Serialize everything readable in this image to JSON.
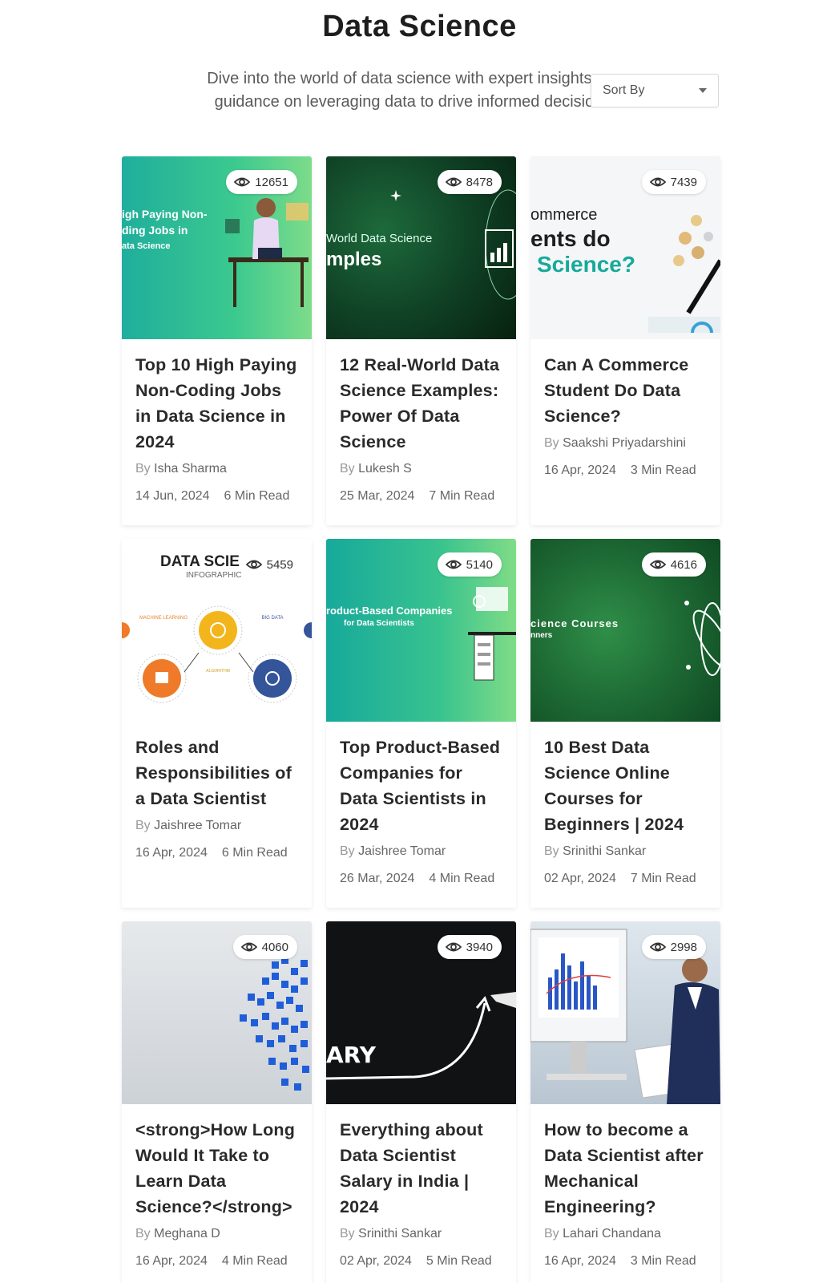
{
  "header": {
    "title": "Data Science",
    "subtitle_line1": "Dive into the world of data science with expert insights ar",
    "subtitle_line2": "guidance on leveraging data to drive informed decision",
    "sort_label": "Sort By"
  },
  "colors": {
    "title": "#1e1e1e",
    "text_muted": "#666666",
    "card_shadow": "rgba(0,0,0,0.08)"
  },
  "cards": [
    {
      "views": "12651",
      "thumb_lines": [
        "igh Paying Non-",
        "ding Jobs in",
        "ata Science"
      ],
      "title": "Top 10 High Paying Non-Coding Jobs in Data Science in 2024",
      "by": "By",
      "author": "Isha Sharma",
      "date": "14 Jun, 2024",
      "read": "6 Min Read"
    },
    {
      "views": "8478",
      "thumb_lines": [
        "World Data Science",
        "mples"
      ],
      "title": "12 Real-World Data Science Examples: Power Of Data Science",
      "by": "By",
      "author": "Lukesh S",
      "date": "25 Mar, 2024",
      "read": "7 Min Read"
    },
    {
      "views": "7439",
      "thumb_lines": [
        "ommerce",
        "ents do",
        "Science?"
      ],
      "title": "Can A Commerce Student Do Data Science?",
      "by": "By",
      "author": "Saakshi Priyadarshini",
      "date": "16 Apr, 2024",
      "read": "3 Min Read"
    },
    {
      "views": "5459",
      "thumb_lines": [
        "DATA SCIE",
        "INFOGRAPHIC",
        "MACHINE LEARNING",
        "BIG DATA",
        "ALGORITHM"
      ],
      "title": "Roles and Responsibilities of a Data Scientist",
      "by": "By",
      "author": "Jaishree Tomar",
      "date": "16 Apr, 2024",
      "read": "6 Min Read"
    },
    {
      "views": "5140",
      "thumb_lines": [
        "roduct-Based Companies",
        "for Data Scientists"
      ],
      "title": "Top Product-Based Companies for Data Scientists in 2024",
      "by": "By",
      "author": "Jaishree Tomar",
      "date": "26 Mar, 2024",
      "read": "4 Min Read"
    },
    {
      "views": "4616",
      "thumb_lines": [
        "cience Courses",
        "nners"
      ],
      "title": "10 Best Data Science Online Courses for Beginners | 2024",
      "by": "By",
      "author": "Srinithi Sankar",
      "date": "02 Apr, 2024",
      "read": "7 Min Read"
    },
    {
      "views": "4060",
      "thumb_lines": [],
      "title": "<strong>How Long Would It Take to Learn Data Science?</strong>",
      "by": "By",
      "author": "Meghana D",
      "date": "16 Apr, 2024",
      "read": "4 Min Read"
    },
    {
      "views": "3940",
      "thumb_lines": [
        "ARY"
      ],
      "title": "Everything about Data Scientist Salary in India | 2024",
      "by": "By",
      "author": "Srinithi Sankar",
      "date": "02 Apr, 2024",
      "read": "5 Min Read"
    },
    {
      "views": "2998",
      "thumb_lines": [],
      "title": "How to become a Data Scientist after Mechanical Engineering?",
      "by": "By",
      "author": "Lahari Chandana",
      "date": "16 Apr, 2024",
      "read": "3 Min Read"
    }
  ]
}
